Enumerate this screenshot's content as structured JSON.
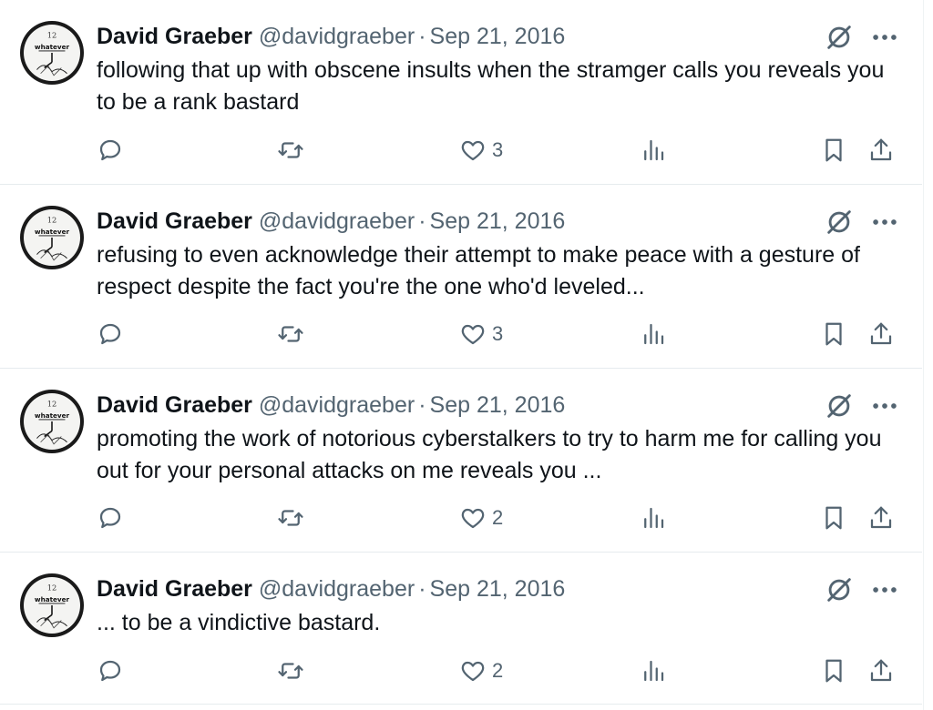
{
  "colors": {
    "text": "#0f1419",
    "secondary": "#536471",
    "divider": "#e6ebee"
  },
  "avatar": {
    "top_text": "12",
    "main_text": "whatever"
  },
  "tweets": [
    {
      "name": "David Graeber",
      "handle": "@davidgraeber",
      "separator": "·",
      "date": "Sep 21, 2016",
      "text": "following that up with obscene insults when the stramger calls you reveals you to be a rank bastard",
      "likes": "3",
      "icons": [
        "reply-icon",
        "retweet-icon",
        "like-icon",
        "views-icon",
        "bookmark-icon",
        "share-icon",
        "grok-icon",
        "more-icon"
      ]
    },
    {
      "name": "David Graeber",
      "handle": "@davidgraeber",
      "separator": "·",
      "date": "Sep 21, 2016",
      "text": "refusing to even acknowledge their attempt to make peace with a gesture of respect despite the fact you're the one who'd leveled...",
      "likes": "3"
    },
    {
      "name": "David Graeber",
      "handle": "@davidgraeber",
      "separator": "·",
      "date": "Sep 21, 2016",
      "text": "promoting the work of notorious cyberstalkers to try to harm me for calling you out for your personal attacks on me reveals you ...",
      "likes": "2"
    },
    {
      "name": "David Graeber",
      "handle": "@davidgraeber",
      "separator": "·",
      "date": "Sep 21, 2016",
      "text": "... to be a vindictive bastard.",
      "likes": "2"
    }
  ]
}
